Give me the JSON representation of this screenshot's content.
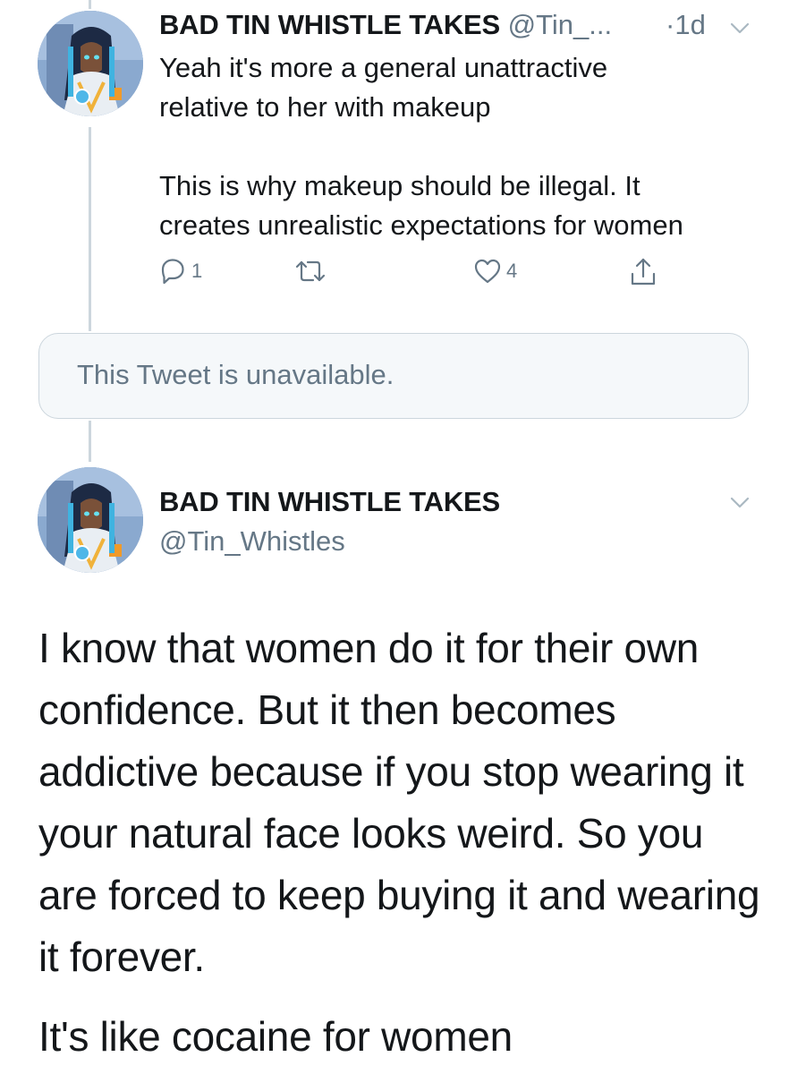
{
  "reply_tweet": {
    "display_name": "BAD TIN WHISTLE TAKES",
    "handle": "@Tin_...",
    "time": "·1d",
    "text_1": "Yeah it's more a general unattractive\nrelative to her with makeup",
    "text_2": "This is why makeup should be illegal. It\ncreates unrealistic expectations for women",
    "actions": {
      "reply_count": "1",
      "retweet_count": "",
      "like_count": "4"
    },
    "icons": [
      "reply-icon",
      "retweet-icon",
      "like-icon",
      "share-icon",
      "chevron-down-icon"
    ]
  },
  "unavailable_tweet": {
    "text": "This Tweet is unavailable."
  },
  "main_tweet": {
    "display_name": "BAD TIN WHISTLE TAKES",
    "handle": "@Tin_Whistles",
    "text_1": "I know that women do it for their own confidence. But it then becomes addictive because if you stop wearing it your natural face looks weird. So you are forced to keep buying it and wearing it forever.",
    "text_2": "It's like cocaine for women"
  },
  "colors": {
    "text_primary": "#14171a",
    "text_secondary": "#657786",
    "border": "#ccd6dd",
    "card_background": "#f5f8fa"
  }
}
